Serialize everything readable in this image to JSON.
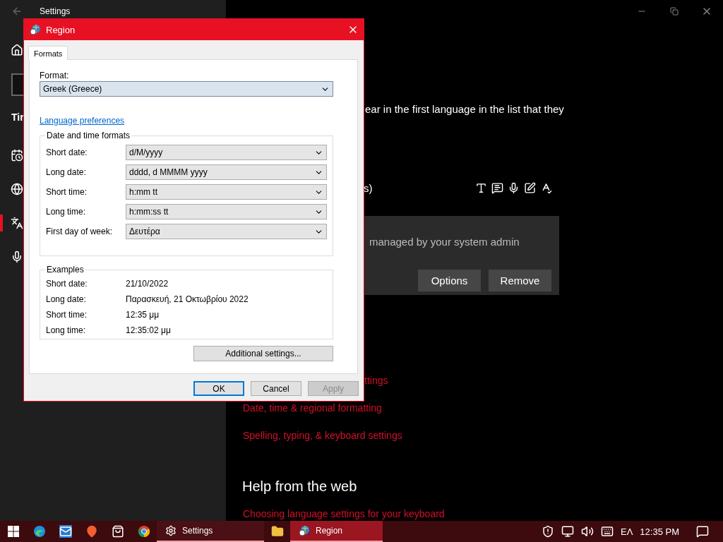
{
  "settings_window": {
    "title": "Settings",
    "sidebar": {
      "heading_fragment": "Tir",
      "items": [
        {
          "kind": "date",
          "selected": false
        },
        {
          "kind": "region",
          "selected": false
        },
        {
          "kind": "language",
          "selected": true
        },
        {
          "kind": "speech",
          "selected": false
        }
      ]
    }
  },
  "content": {
    "description_fragment": "ear in the first language in the list that they",
    "feature_fragment": "s)",
    "notice": {
      "text": "managed by your system admin",
      "buttons": [
        "Options",
        "Remove"
      ]
    },
    "related_links": [
      "ttings",
      "Date, time & regional formatting",
      "Spelling, typing, & keyboard settings"
    ],
    "help_heading": "Help from the web",
    "help_links": [
      "Choosing language settings for your keyboard"
    ]
  },
  "dialog": {
    "title": "Region",
    "tabs": [
      {
        "label": "Formats",
        "selected": true
      }
    ],
    "format_label": "Format:",
    "format_value": "Greek (Greece)",
    "link": "Language preferences",
    "formats_group": {
      "title": "Date and time formats",
      "fields": [
        {
          "label": "Short date:",
          "value": "d/M/yyyy"
        },
        {
          "label": "Long date:",
          "value": "dddd, d MMMM yyyy"
        },
        {
          "label": "Short time:",
          "value": "h:mm tt"
        },
        {
          "label": "Long time:",
          "value": "h:mm:ss tt"
        },
        {
          "label": "First day of week:",
          "value": "Δευτέρα"
        }
      ]
    },
    "examples_group": {
      "title": "Examples",
      "rows": [
        {
          "label": "Short date:",
          "value": "21/10/2022"
        },
        {
          "label": "Long date:",
          "value": "Παρασκευή, 21 Οκτωβρίου 2022"
        },
        {
          "label": "Short time:",
          "value": "12:35 μμ"
        },
        {
          "label": "Long time:",
          "value": "12:35:02 μμ"
        }
      ]
    },
    "additional_button": "Additional settings...",
    "buttons": [
      {
        "label": "OK",
        "default": true,
        "disabled": false
      },
      {
        "label": "Cancel",
        "default": false,
        "disabled": false
      },
      {
        "label": "Apply",
        "default": false,
        "disabled": true
      }
    ]
  },
  "taskbar": {
    "apps": [
      {
        "kind": "edge"
      },
      {
        "kind": "mail"
      },
      {
        "kind": "maps"
      },
      {
        "kind": "store"
      },
      {
        "kind": "chrome"
      },
      {
        "kind": "settings",
        "label": "Settings",
        "active": true
      },
      {
        "kind": "explorer"
      },
      {
        "kind": "region",
        "label": "Region",
        "active": true,
        "focused": true
      }
    ],
    "language": "ΕΛ",
    "time": "12:35 PM"
  }
}
